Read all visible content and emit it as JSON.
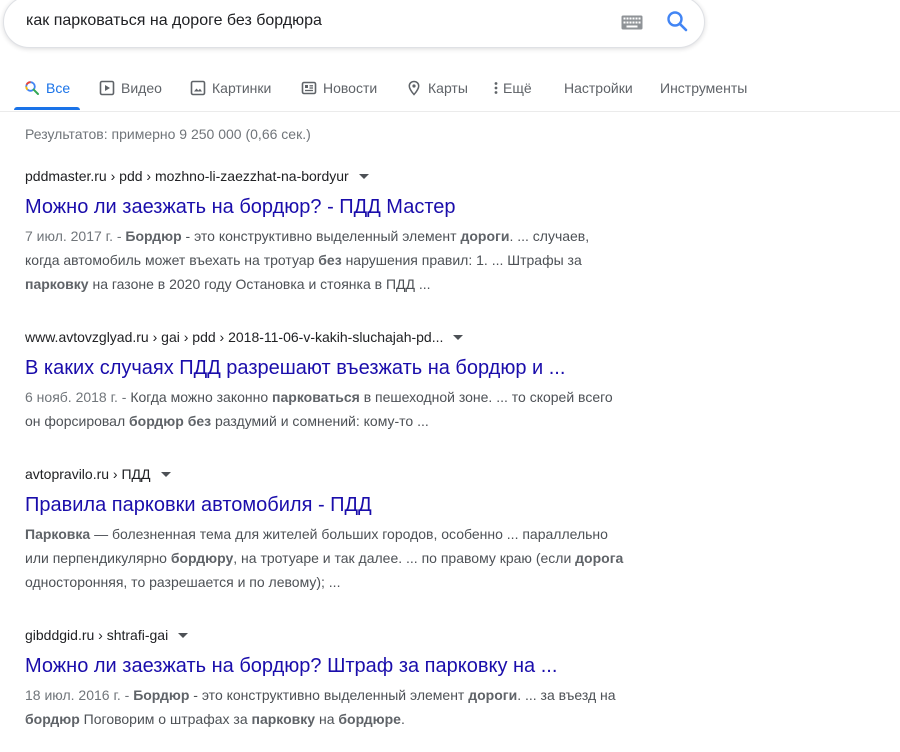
{
  "search": {
    "query": "как парковаться на дороге без бордюра"
  },
  "tabs": [
    {
      "label": "Все",
      "icon": "search-icon"
    },
    {
      "label": "Видео",
      "icon": "video-icon"
    },
    {
      "label": "Картинки",
      "icon": "image-icon"
    },
    {
      "label": "Новости",
      "icon": "news-icon"
    },
    {
      "label": "Карты",
      "icon": "map-pin-icon"
    },
    {
      "label": "Ещё",
      "icon": "more-vert-icon"
    },
    {
      "label": "Настройки"
    },
    {
      "label": "Инструменты"
    }
  ],
  "result_stats": "Результатов: примерно 9 250 000 (0,66 сек.)",
  "colors": {
    "link": "#1a0dab",
    "active_tab": "#1a73e8",
    "snippet": "#4d5156",
    "meta": "#70757a"
  },
  "results": [
    {
      "cite": "pddmaster.ru › pdd › mozhno-li-zaezzhat-na-bordyur",
      "title": "Можно ли заезжать на бордюр? - ПДД Мастер",
      "snippet_lines": [
        [
          {
            "t": "7 июл. 2017 г. - ",
            "k": "date"
          },
          {
            "t": "Бордюр",
            "k": "b"
          },
          {
            "t": " - это конструктивно выделенный элемент ",
            "k": "n"
          },
          {
            "t": "дороги",
            "k": "b"
          },
          {
            "t": ". ... случаев,",
            "k": "n"
          }
        ],
        [
          {
            "t": "когда автомобиль может въехать на тротуар ",
            "k": "n"
          },
          {
            "t": "без",
            "k": "b"
          },
          {
            "t": " нарушения правил: 1. ... Штрафы за",
            "k": "n"
          }
        ],
        [
          {
            "t": "парковку",
            "k": "b"
          },
          {
            "t": " на газоне в 2020 году Остановка и стоянка в ПДД ...",
            "k": "n"
          }
        ]
      ]
    },
    {
      "cite": "www.avtovzglyad.ru › gai › pdd › 2018-11-06-v-kakih-sluchajah-pd...",
      "title": "В каких случаях ПДД разрешают въезжать на бордюр и ...",
      "snippet_lines": [
        [
          {
            "t": "6 нояб. 2018 г. - ",
            "k": "date"
          },
          {
            "t": "Когда можно законно ",
            "k": "n"
          },
          {
            "t": "парковаться",
            "k": "b"
          },
          {
            "t": " в пешеходной зоне. ... то скорей всего",
            "k": "n"
          }
        ],
        [
          {
            "t": "он форсировал ",
            "k": "n"
          },
          {
            "t": "бордюр без",
            "k": "b"
          },
          {
            "t": " раздумий и сомнений: кому-то ...",
            "k": "n"
          }
        ]
      ]
    },
    {
      "cite": "avtopravilo.ru › ПДД",
      "title": "Правила парковки автомобиля - ПДД",
      "snippet_lines": [
        [
          {
            "t": "Парковка",
            "k": "b"
          },
          {
            "t": " — болезненная тема для жителей больших городов, особенно ... параллельно",
            "k": "n"
          }
        ],
        [
          {
            "t": "или перпендикулярно ",
            "k": "n"
          },
          {
            "t": "бордюру",
            "k": "b"
          },
          {
            "t": ", на тротуаре и так далее. ... по правому краю (если ",
            "k": "n"
          },
          {
            "t": "дорога",
            "k": "b"
          }
        ],
        [
          {
            "t": "односторонняя, то разрешается и по левому); ...",
            "k": "n"
          }
        ]
      ]
    },
    {
      "cite": "gibddgid.ru › shtrafi-gai",
      "title": "Можно ли заезжать на бордюр? Штраф за парковку на ...",
      "snippet_lines": [
        [
          {
            "t": "18 июл. 2016 г. - ",
            "k": "date"
          },
          {
            "t": "Бордюр",
            "k": "b"
          },
          {
            "t": " - это конструктивно выделенный элемент ",
            "k": "n"
          },
          {
            "t": "дороги",
            "k": "b"
          },
          {
            "t": ". ... за въезд на",
            "k": "n"
          }
        ],
        [
          {
            "t": "бордюр",
            "k": "b"
          },
          {
            "t": " Поговорим о штрафах за ",
            "k": "n"
          },
          {
            "t": "парковку",
            "k": "b"
          },
          {
            "t": " на ",
            "k": "n"
          },
          {
            "t": "бордюре",
            "k": "b"
          },
          {
            "t": ".",
            "k": "n"
          }
        ]
      ]
    }
  ]
}
